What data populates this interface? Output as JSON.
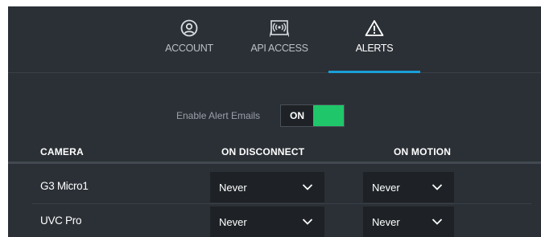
{
  "tabs": [
    {
      "label": "ACCOUNT",
      "icon": "user-circle-icon",
      "active": false
    },
    {
      "label": "API ACCESS",
      "icon": "api-signal-icon",
      "active": false
    },
    {
      "label": "ALERTS",
      "icon": "warning-triangle-icon",
      "active": true
    }
  ],
  "alerts": {
    "enable_label": "Enable Alert Emails",
    "toggle_state": "ON"
  },
  "table": {
    "columns": [
      "CAMERA",
      "ON DISCONNECT",
      "ON MOTION"
    ],
    "rows": [
      {
        "camera": "G3 Micro1",
        "on_disconnect": "Never",
        "on_motion": "Never"
      },
      {
        "camera": "UVC Pro",
        "on_disconnect": "Never",
        "on_motion": "Never"
      }
    ]
  },
  "colors": {
    "panel_bg": "#2b3036",
    "accent_tab": "#1a9fd9",
    "toggle_on": "#1fc76a",
    "select_bg": "#1e2226"
  }
}
